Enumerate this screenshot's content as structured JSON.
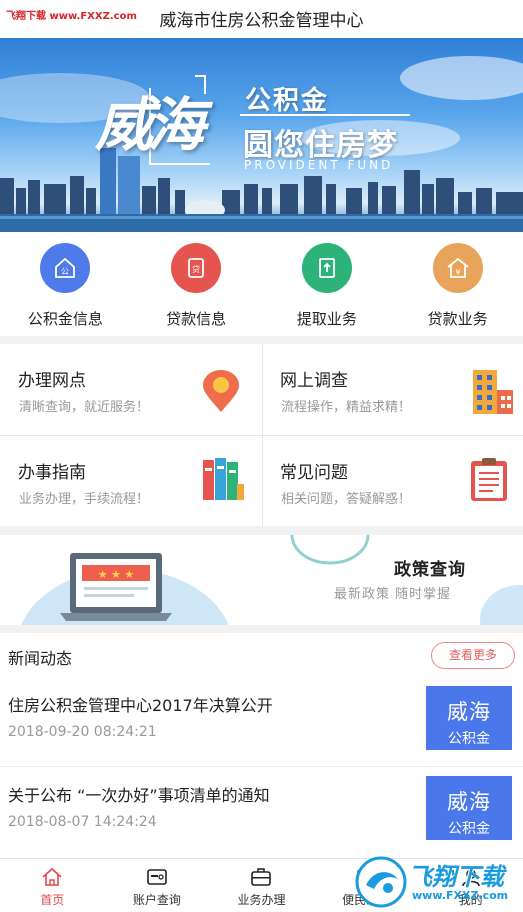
{
  "watermark_top": "飞翔下载 www.FXXZ.com",
  "app_title": "威海市住房公积金管理中心",
  "banner": {
    "calligraphy": "威海",
    "headline": "公积金",
    "slogan": "圆您住房梦",
    "english": "PROVIDENT FUND"
  },
  "quick_icons": [
    {
      "label": "公积金信息",
      "color": "#4f7bea",
      "icon": "house-icon"
    },
    {
      "label": "贷款信息",
      "color": "#e5544f",
      "icon": "loan-document-icon"
    },
    {
      "label": "提取业务",
      "color": "#2db27a",
      "icon": "withdraw-book-icon"
    },
    {
      "label": "贷款业务",
      "color": "#e8a45a",
      "icon": "house-yen-icon"
    }
  ],
  "services": [
    {
      "title": "办理网点",
      "subtitle": "清晰查询，就近服务！",
      "icon": "location-pin-icon"
    },
    {
      "title": "网上调查",
      "subtitle": "流程操作，精益求精！",
      "icon": "building-icon"
    },
    {
      "title": "办事指南",
      "subtitle": "业务办理，手续流程！",
      "icon": "binders-icon"
    },
    {
      "title": "常见问题",
      "subtitle": "相关问题，答疑解惑！",
      "icon": "clipboard-icon"
    }
  ],
  "policy": {
    "title": "政策查询",
    "subtitle": "最新政策 随时掌握"
  },
  "news": {
    "heading": "新闻动态",
    "more": "查看更多",
    "items": [
      {
        "title": "住房公积金管理中心2017年决算公开",
        "time": "2018-09-20 08:24:21",
        "thumb_big": "威海",
        "thumb_small": "公积金"
      },
      {
        "title": "关于公布 “一次办好”事项清单的通知",
        "time": "2018-08-07 14:24:24",
        "thumb_big": "威海",
        "thumb_small": "公积金"
      }
    ]
  },
  "tabs": [
    {
      "label": "首页",
      "icon": "home-icon",
      "active": true
    },
    {
      "label": "账户查询",
      "icon": "account-card-icon",
      "active": false
    },
    {
      "label": "业务办理",
      "icon": "briefcase-icon",
      "active": false
    },
    {
      "label": "便民工具",
      "icon": "tools-icon",
      "active": false
    },
    {
      "label": "我的",
      "icon": "user-icon",
      "active": false
    }
  ],
  "watermark_badge": {
    "logo_text": "飞翔下载",
    "url": "www.FXXZ.com"
  }
}
